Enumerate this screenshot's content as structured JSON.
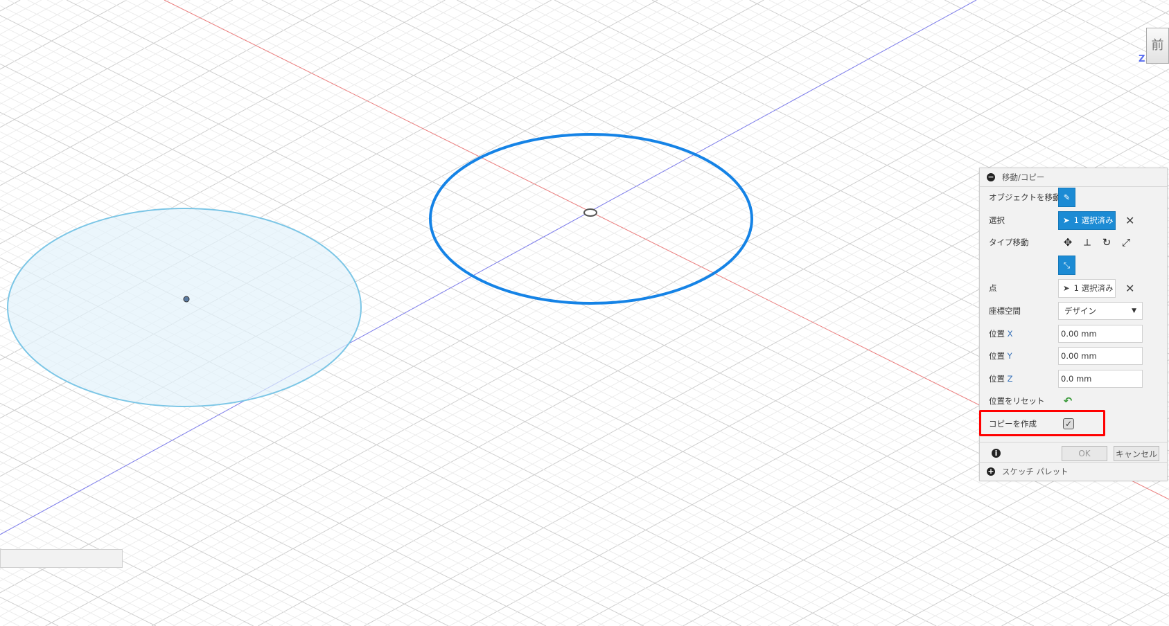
{
  "viewcube": {
    "face_label": "前",
    "axis_label": "Z"
  },
  "panel": {
    "title": "移動/コピー",
    "rows": {
      "move_object": {
        "label": "オブジェクトを移動"
      },
      "selection": {
        "label": "選択",
        "value": "1 選択済み"
      },
      "move_type": {
        "label": "タイプ移動"
      },
      "point": {
        "label": "点",
        "value": "1 選択済み"
      },
      "coord_space": {
        "label": "座標空間",
        "value": "デザイン"
      },
      "pos_x": {
        "label": "位置",
        "axis": "X",
        "value": "0.00 mm"
      },
      "pos_y": {
        "label": "位置",
        "axis": "Y",
        "value": "0.00 mm"
      },
      "pos_z": {
        "label": "位置",
        "axis": "Z",
        "value": "0.0 mm"
      },
      "reset": {
        "label": "位置をリセット"
      },
      "create_copy": {
        "label": "コピーを作成",
        "checked": true
      }
    },
    "ok_label": "OK",
    "cancel_label": "キャンセル",
    "sketch_palette": "スケッチ パレット"
  },
  "colors": {
    "accent": "#1c8bd4",
    "highlight": "#ff0000",
    "sketch_circle": "#1583e6",
    "profile_fill": "#e3f2fb"
  }
}
